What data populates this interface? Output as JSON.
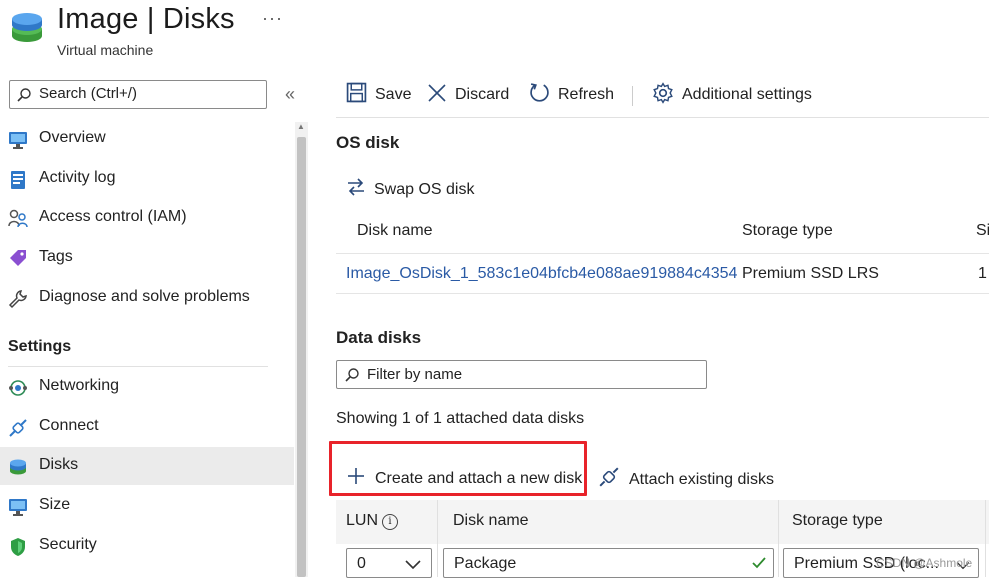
{
  "header": {
    "title": "Image | Disks",
    "subtitle": "Virtual machine",
    "more": "···"
  },
  "sidebar": {
    "search_placeholder": "Search (Ctrl+/)",
    "collapse": "«",
    "items_top": [
      {
        "label": "Overview",
        "icon": "monitor-icon"
      },
      {
        "label": "Activity log",
        "icon": "activity-log-icon"
      },
      {
        "label": "Access control (IAM)",
        "icon": "people-icon"
      },
      {
        "label": "Tags",
        "icon": "tag-icon"
      },
      {
        "label": "Diagnose and solve problems",
        "icon": "wrench-icon"
      }
    ],
    "section": "Settings",
    "items_settings": [
      {
        "label": "Networking",
        "icon": "network-icon"
      },
      {
        "label": "Connect",
        "icon": "plug-icon"
      },
      {
        "label": "Disks",
        "icon": "disk-icon",
        "selected": true
      },
      {
        "label": "Size",
        "icon": "monitor-icon"
      },
      {
        "label": "Security",
        "icon": "shield-icon"
      }
    ]
  },
  "toolbar": {
    "save": "Save",
    "discard": "Discard",
    "refresh": "Refresh",
    "additional": "Additional settings"
  },
  "os_disk": {
    "heading": "OS disk",
    "swap": "Swap OS disk",
    "columns": [
      "Disk name",
      "Storage type",
      "Si"
    ],
    "row": {
      "name": "Image_OsDisk_1_583c1e04bfcb4e088ae919884c4354",
      "storage": "Premium SSD LRS",
      "size": "1"
    }
  },
  "data_disks": {
    "heading": "Data disks",
    "filter_placeholder": "Filter by name",
    "showing": "Showing 1 of 1 attached data disks",
    "create": "Create and attach a new disk",
    "attach": "Attach existing disks",
    "columns": {
      "lun": "LUN",
      "name": "Disk name",
      "storage": "Storage type"
    },
    "row": {
      "lun": "0",
      "name": "Package",
      "storage": "Premium SSD (loc..."
    }
  },
  "watermark": "CSDN @Ashmole",
  "colors": {
    "accent": "#2a5aa5",
    "highlight": "#e8232a",
    "selected_bg": "#ebebeb"
  }
}
